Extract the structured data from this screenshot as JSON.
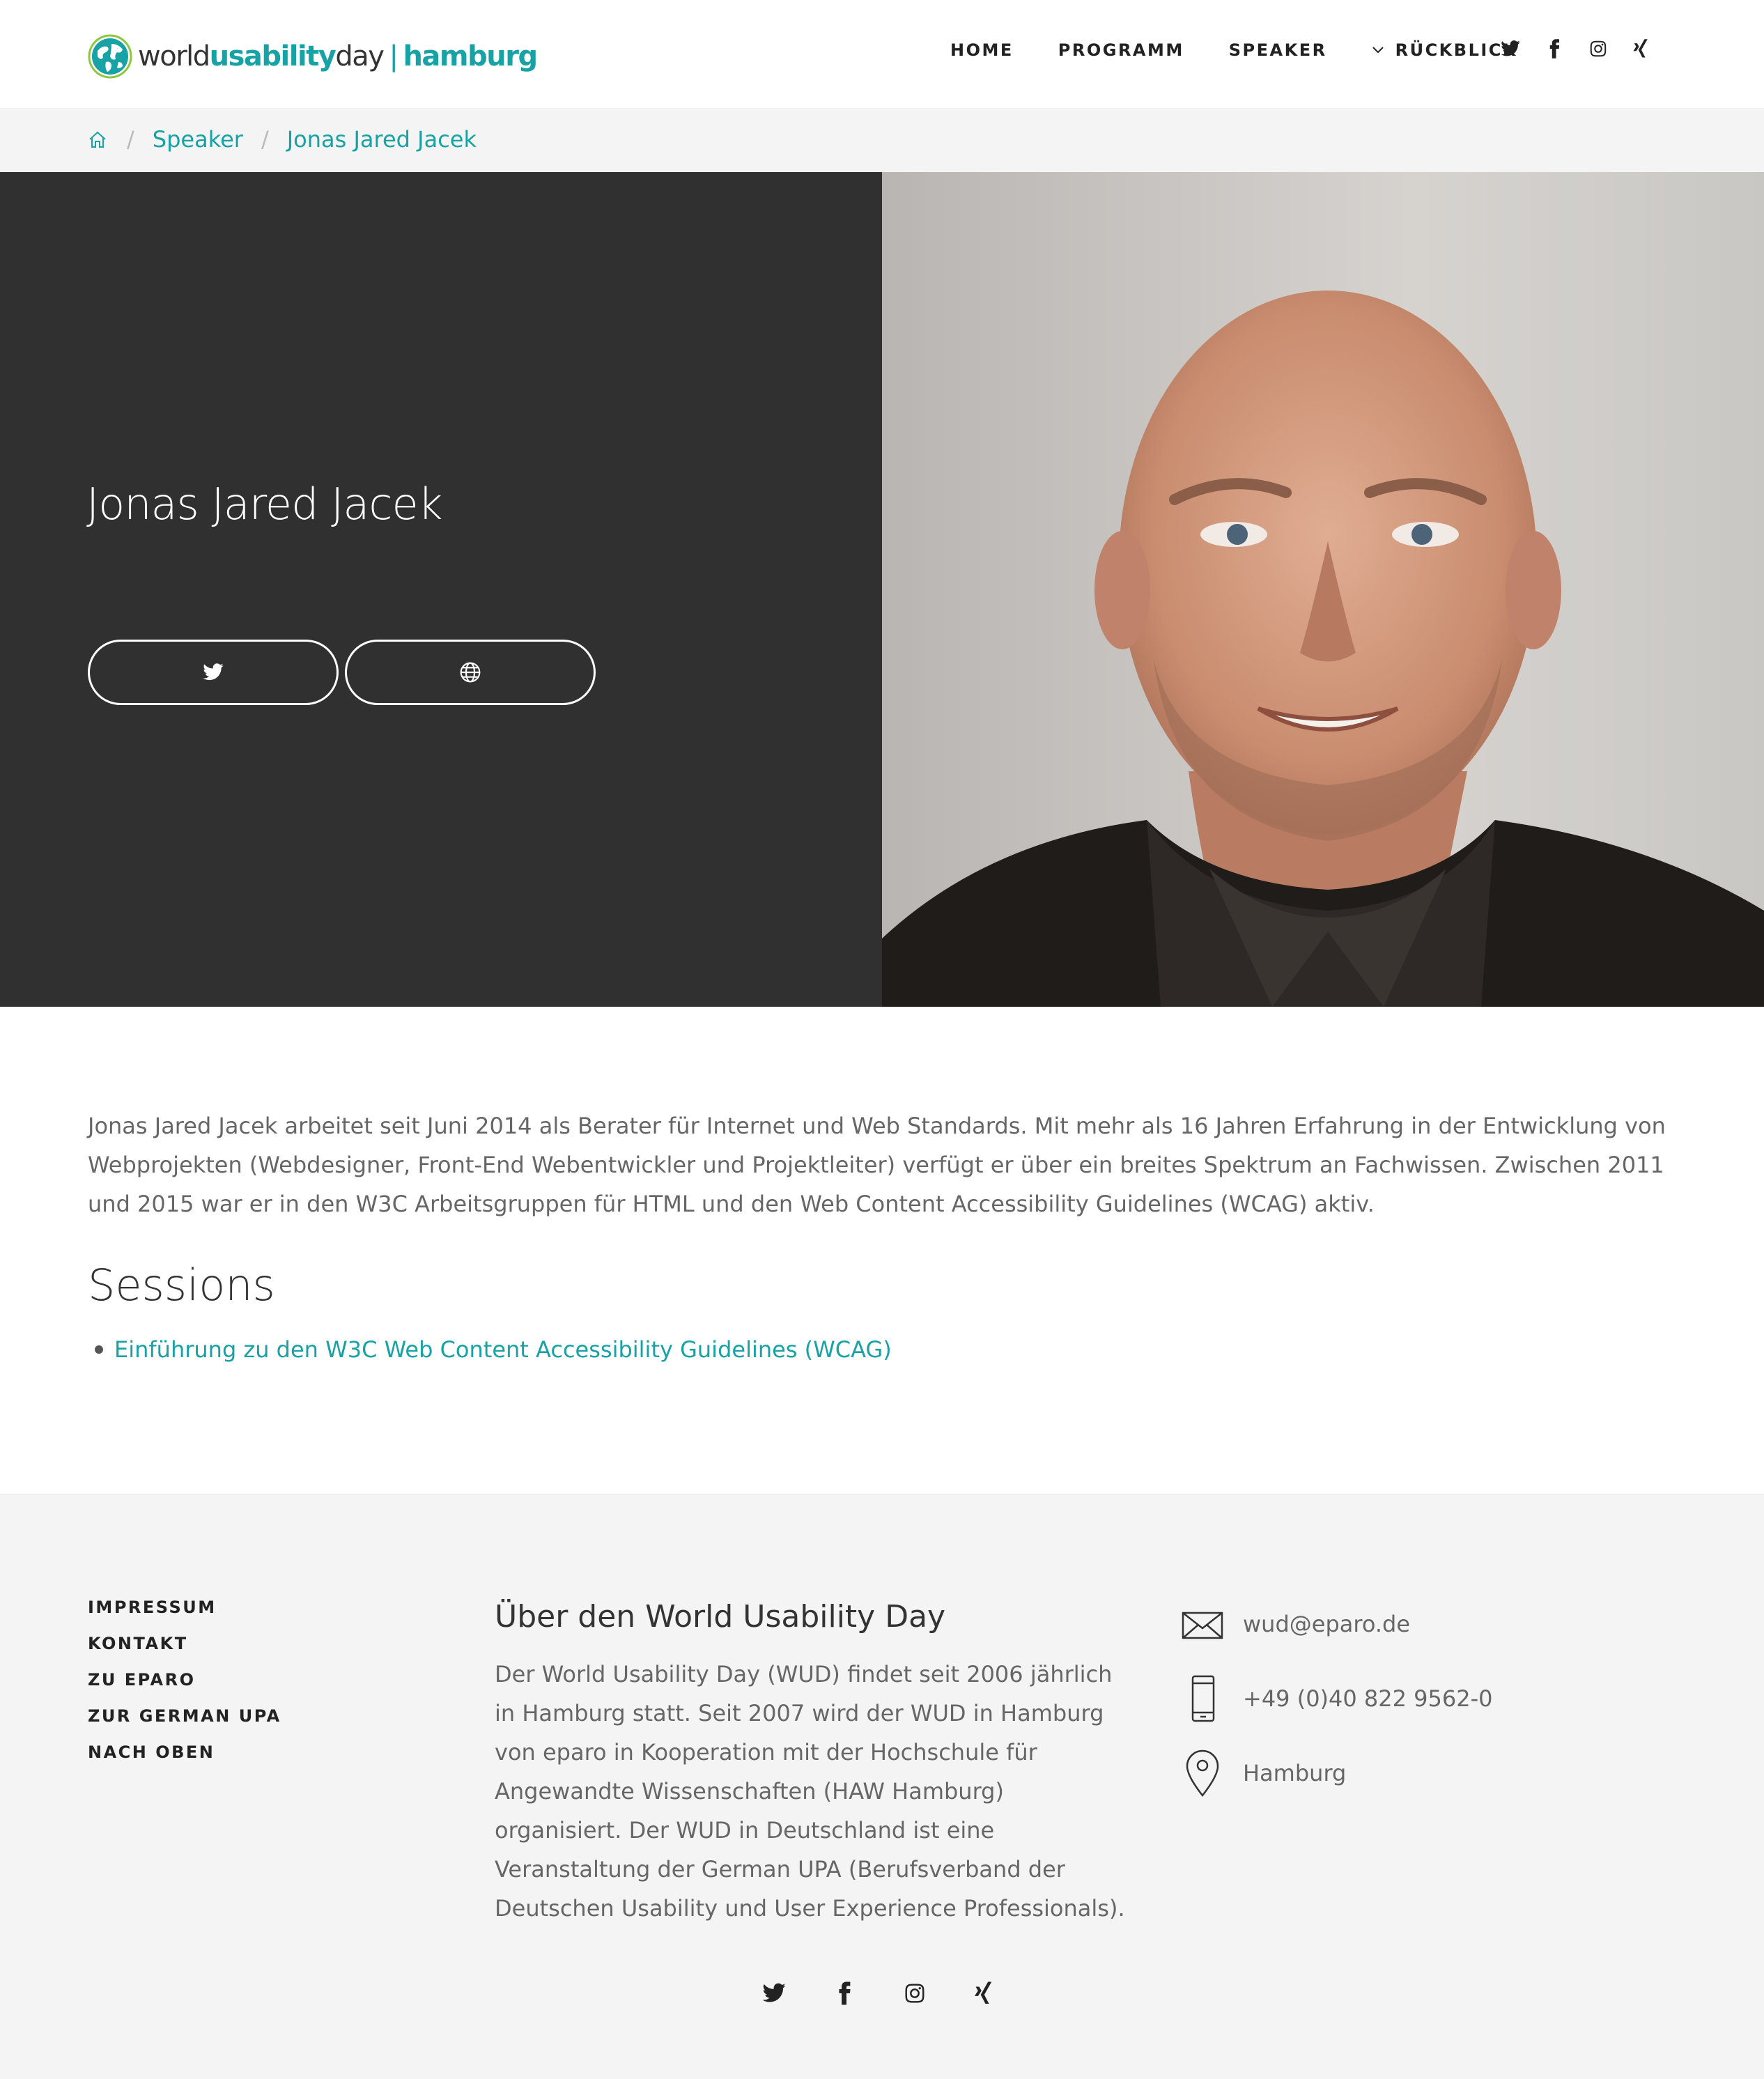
{
  "logo": {
    "world": "world",
    "usability": "usability",
    "day": "day",
    "separator": "|",
    "city": "hamburg"
  },
  "nav": {
    "items": [
      "Home",
      "Programm",
      "Speaker",
      "Rückblick"
    ],
    "social_icons": [
      "twitter-icon",
      "facebook-icon",
      "instagram-icon",
      "xing-icon"
    ]
  },
  "breadcrumb": {
    "items": [
      "Speaker",
      "Jonas Jared Jacek"
    ],
    "separator": "/"
  },
  "hero": {
    "name": "Jonas Jared Jacek",
    "buttons": [
      "twitter-icon",
      "globe-icon"
    ]
  },
  "bio": "Jonas Jared Jacek arbeitet seit Juni 2014 als Berater für Internet und Web Standards. Mit mehr als 16 Jahren Erfahrung in der Entwicklung von Webprojekten (Webdesigner, Front-End Webentwickler und Projektleiter) verfügt er über ein breites Spektrum an Fachwissen. Zwischen 2011 und 2015 war er in den W3C Arbeitsgruppen für HTML und den Web Content Accessibility Guidelines (WCAG) aktiv.",
  "sessions": {
    "title": "Sessions",
    "items": [
      "Einführung zu den W3C Web Content Accessibility Guidelines (WCAG)"
    ]
  },
  "footer": {
    "links": [
      "Impressum",
      "Kontakt",
      "zu eparo",
      "zur German UPA",
      "nach oben"
    ],
    "about_title": "Über den World Usability Day",
    "about_text": "Der World Usability Day (WUD) findet seit 2006 jährlich in Hamburg statt. Seit 2007 wird der WUD in Hamburg von eparo in Kooperation mit der Hochschule für Angewandte Wissenschaften (HAW Hamburg) organisiert. Der WUD in Deutschland ist eine Veranstaltung der German UPA (Berufsverband der Deutschen Usability und User Experience Professionals).",
    "contact": {
      "email": "wud@eparo.de",
      "phone": "+49 (0)40 822 9562-0",
      "location": "Hamburg"
    },
    "social_icons": [
      "twitter-icon",
      "facebook-icon",
      "instagram-icon",
      "xing-icon"
    ]
  },
  "colors": {
    "accent": "#17a2a6",
    "hero_dark": "#303030",
    "footer_bg": "#f4f4f4"
  }
}
